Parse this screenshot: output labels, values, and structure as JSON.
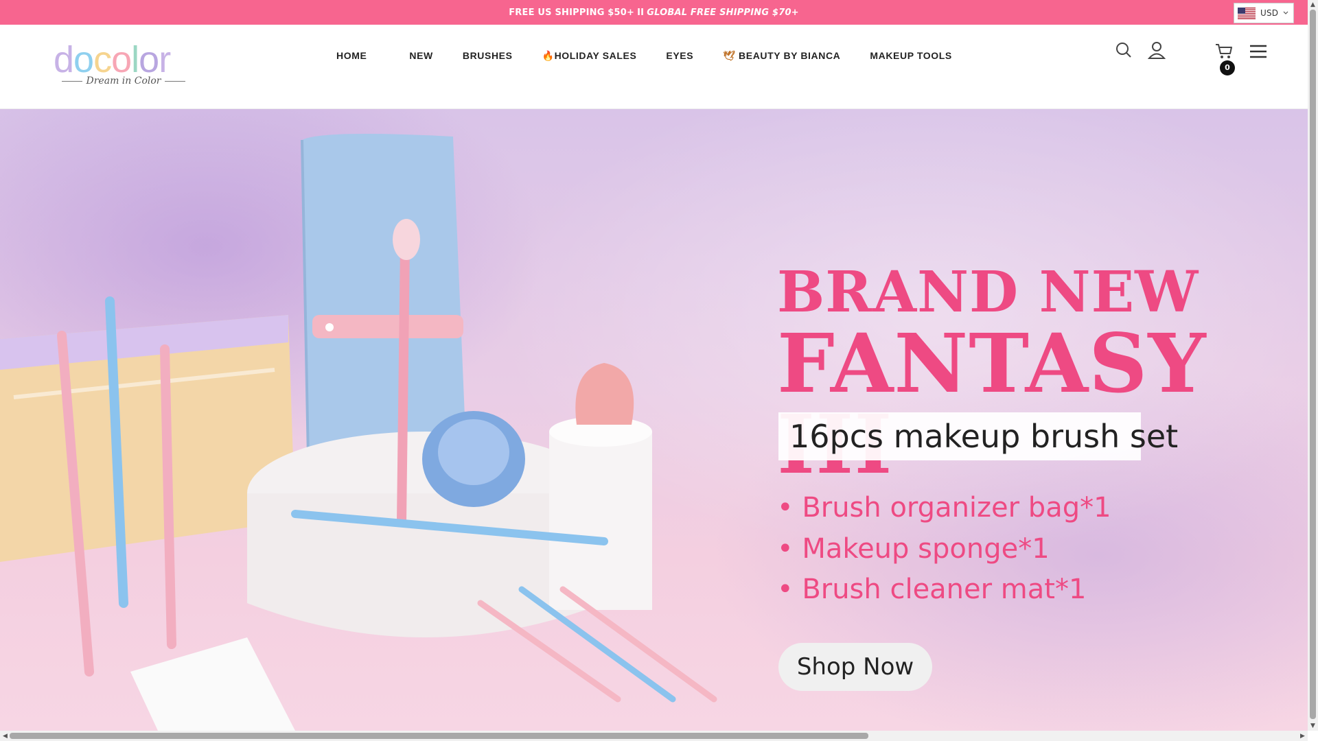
{
  "topbar": {
    "text_regular": "FREE US SHIPPING $50+",
    "separator": "II",
    "text_emphasis": "GLOBAL FREE SHIPPING $70+",
    "currency": "USD"
  },
  "logo": {
    "letters": [
      "d",
      "o",
      "c",
      "o",
      "l",
      "o",
      "r"
    ],
    "letter_colors": [
      "#c7b2e6",
      "#8fd0ef",
      "#f6d48f",
      "#f7a6b5",
      "#9bd7c3",
      "#b8a6e0",
      "#c7b2e6"
    ],
    "tagline": "Dream in Color"
  },
  "nav": {
    "items": [
      {
        "label": "HOME"
      },
      {
        "label": "NEW"
      },
      {
        "label": "BRUSHES"
      },
      {
        "label": "HOLIDAY SALES",
        "icon": "fire-icon",
        "glyph": "🔥"
      },
      {
        "label": "EYES"
      },
      {
        "label": "BEAUTY BY BIANCA",
        "icon": "bird-icon",
        "glyph": "🕊"
      },
      {
        "label": "MAKEUP TOOLS"
      }
    ]
  },
  "header_icons": {
    "search": "search-icon",
    "account": "user-icon",
    "cart": "cart-icon",
    "cart_count": "0",
    "menu": "hamburger-menu-icon"
  },
  "hero": {
    "title_line1": "BRAND NEW",
    "title_line2": "FANTASY III",
    "subtitle": "16pcs makeup brush set",
    "bullets": [
      "Brush organizer bag*1",
      "Makeup sponge*1",
      "Brush cleaner mat*1"
    ],
    "cta": "Shop Now",
    "accent_color": "#ee4a83"
  },
  "colors": {
    "topbar": "#f7658f",
    "text": "#222222"
  }
}
